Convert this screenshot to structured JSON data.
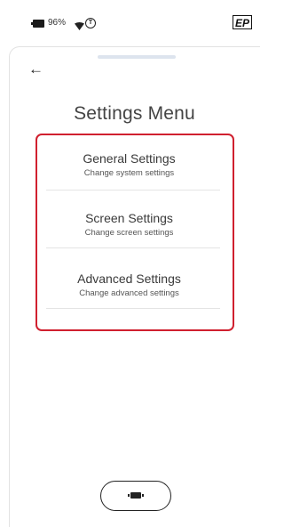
{
  "status_bar": {
    "battery_percent": "96%",
    "battery_icon": "battery-icon",
    "wifi_icon": "wifi-icon",
    "status_icon": "circle-status-icon",
    "logo_text": "EP"
  },
  "header": {
    "back_label": "←",
    "title": "Settings Menu"
  },
  "menu": {
    "items": [
      {
        "title": "General Settings",
        "subtitle": "Change system settings"
      },
      {
        "title": "Screen Settings",
        "subtitle": "Change screen settings"
      },
      {
        "title": "Advanced Settings",
        "subtitle": "Change advanced settings"
      }
    ],
    "highlight_color": "#d0202f"
  },
  "footer": {
    "home_icon": "home-button-icon"
  }
}
